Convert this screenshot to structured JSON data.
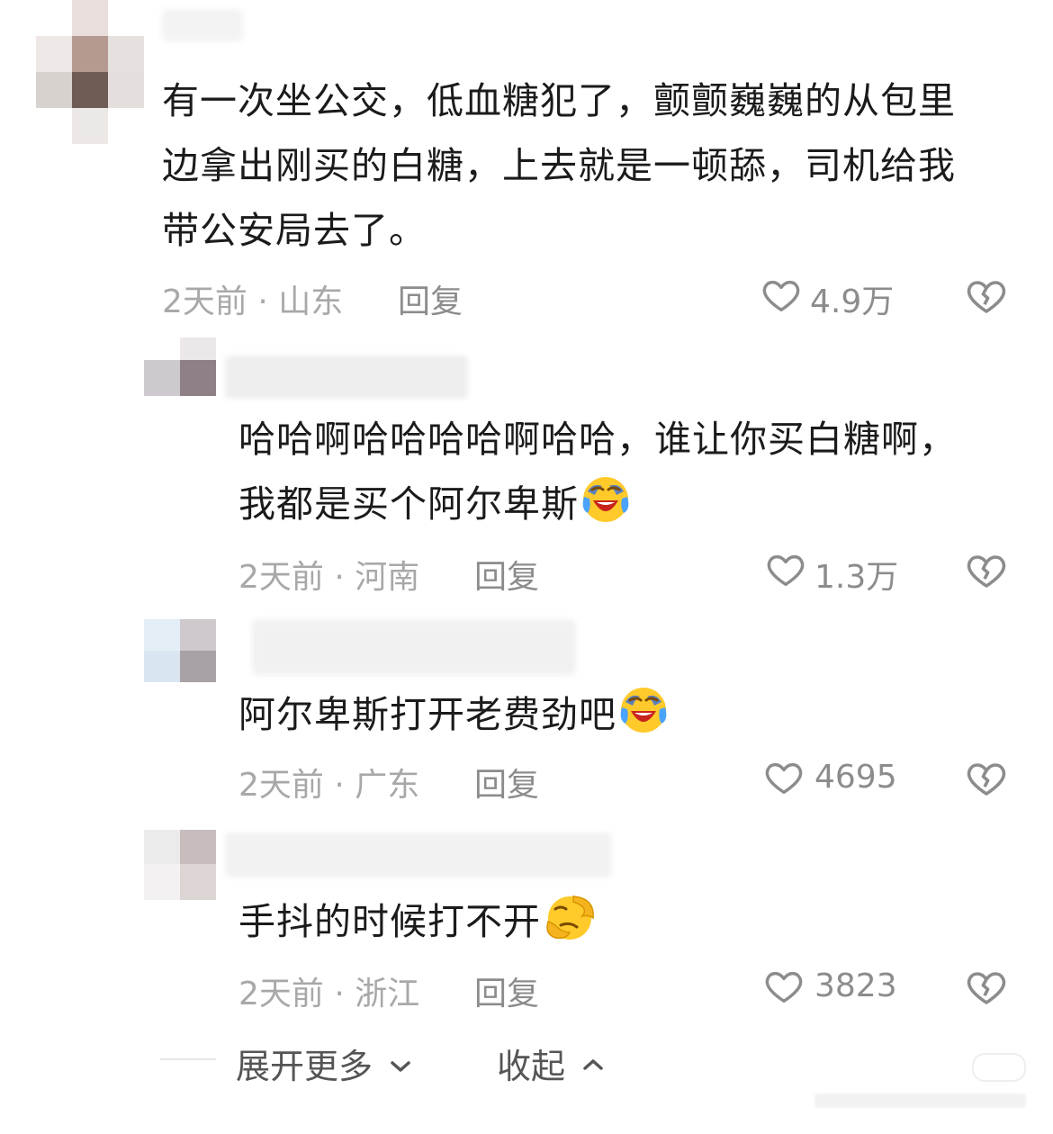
{
  "comments": [
    {
      "text_lines": [
        "有一次坐公交，低血糖犯了，颤颤巍巍的从包里",
        "边拿出刚买的白糖，上去就是一顿舔，司机给我",
        "带公安局去了。"
      ],
      "time": "2天前",
      "location": "山东",
      "reply_label": "回复",
      "likes": "4.9万"
    },
    {
      "text_lines": [
        "哈哈啊哈哈哈哈啊哈哈，谁让你买白糖啊，",
        "我都是买个阿尔卑斯"
      ],
      "emoji": "laughing-crying-emoji",
      "time": "2天前",
      "location": "河南",
      "reply_label": "回复",
      "likes": "1.3万"
    },
    {
      "text_lines": [
        "阿尔卑斯打开老费劲吧"
      ],
      "emoji": "laughing-crying-emoji",
      "time": "2天前",
      "location": "广东",
      "reply_label": "回复",
      "likes": "4695"
    },
    {
      "text_lines": [
        "手抖的时候打不开"
      ],
      "emoji": "facepalm-emoji",
      "time": "2天前",
      "location": "浙江",
      "reply_label": "回复",
      "likes": "3823"
    }
  ],
  "footer": {
    "expand_label": "展开更多",
    "collapse_label": "收起"
  },
  "icons": {
    "like": "heart-outline-icon",
    "dislike": "broken-heart-icon",
    "expand": "chevron-down-icon",
    "collapse": "chevron-up-icon"
  }
}
